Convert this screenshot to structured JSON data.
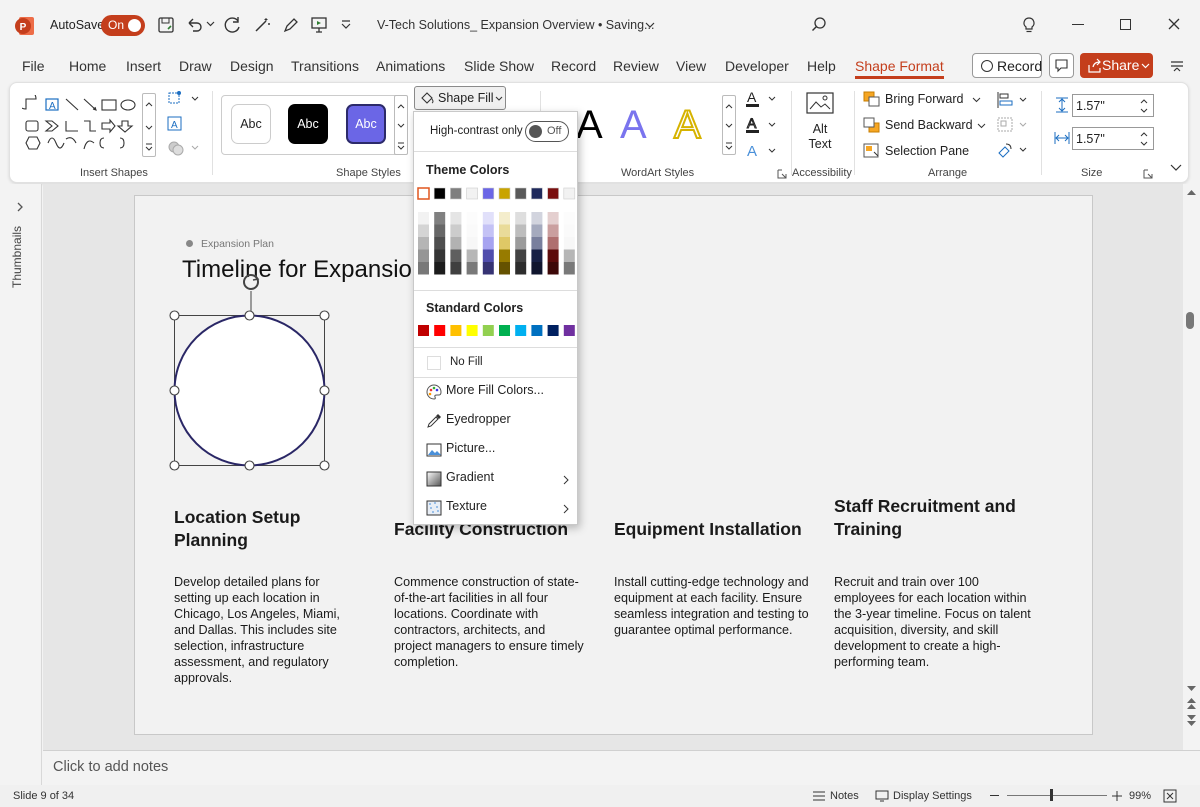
{
  "titlebar": {
    "autosave_label": "AutoSave",
    "autosave_state": "On",
    "doc_title": "V-Tech Solutions_ Expansion Overview • Saving..."
  },
  "menu": {
    "tabs": [
      "File",
      "Home",
      "Insert",
      "Draw",
      "Design",
      "Transitions",
      "Animations",
      "Slide Show",
      "Record",
      "Review",
      "View",
      "Developer",
      "Help",
      "Shape Format"
    ],
    "record_label": "Record",
    "share_label": "Share"
  },
  "ribbon": {
    "insert_shapes_label": "Insert Shapes",
    "shape_styles_label": "Shape Styles",
    "style_samples": [
      "Abc",
      "Abc",
      "Abc"
    ],
    "shape_fill_label": "Shape Fill",
    "wordart_label": "WordArt Styles",
    "accessibility_label": "Accessibility",
    "alt_text_label": "Alt\nText",
    "arrange_label": "Arrange",
    "bring_forward": "Bring Forward",
    "send_backward": "Send Backward",
    "selection_pane": "Selection Pane",
    "size_label": "Size",
    "height_value": "1.57\"",
    "width_value": "1.57\""
  },
  "dropdown": {
    "high_contrast_label": "High-contrast only",
    "toggle_state": "Off",
    "theme_header": "Theme Colors",
    "standard_header": "Standard Colors",
    "no_fill": "No Fill",
    "more_colors": "More Fill Colors...",
    "eyedropper": "Eyedropper",
    "picture": "Picture...",
    "gradient": "Gradient",
    "texture": "Texture",
    "theme_colors": [
      "#ffffff",
      "#000000",
      "#7f7f7f",
      "#f2f2f2",
      "#6b66e6",
      "#c9a400",
      "#595959",
      "#1f2a5c",
      "#7a0f0f",
      "#f2f2f2"
    ],
    "standard_colors": [
      "#c00000",
      "#ff0000",
      "#ffc000",
      "#ffff00",
      "#92d050",
      "#00b050",
      "#00b0f0",
      "#0070c0",
      "#002060",
      "#7030a0"
    ]
  },
  "sidebar": {
    "thumbnails_label": "Thumbnails"
  },
  "slide": {
    "eyebrow": "Expansion Plan",
    "title": "Timeline for Expansion",
    "columns": [
      {
        "title": "Location Setup Planning",
        "body": "Develop detailed plans for setting up each location in Chicago, Los Angeles, Miami, and Dallas. This includes site selection, infrastructure assessment, and regulatory approvals."
      },
      {
        "title": "Facility Construction",
        "body": "Commence construction of state-of-the-art facilities in all four locations. Coordinate with contractors, architects, and project managers to ensure timely completion."
      },
      {
        "title": "Equipment Installation",
        "body": "Install cutting-edge technology and equipment at each facility. Ensure seamless integration and testing to guarantee optimal performance."
      },
      {
        "title": "Staff Recruitment and Training",
        "body": "Recruit and train over 100 employees for each location within the 3-year timeline. Focus on talent acquisition, diversity, and skill development to create a high-performing team."
      }
    ]
  },
  "notes_placeholder": "Click to add notes",
  "status": {
    "slide_info": "Slide 9 of 34",
    "notes_label": "Notes",
    "display_settings": "Display Settings",
    "zoom": "99%"
  }
}
